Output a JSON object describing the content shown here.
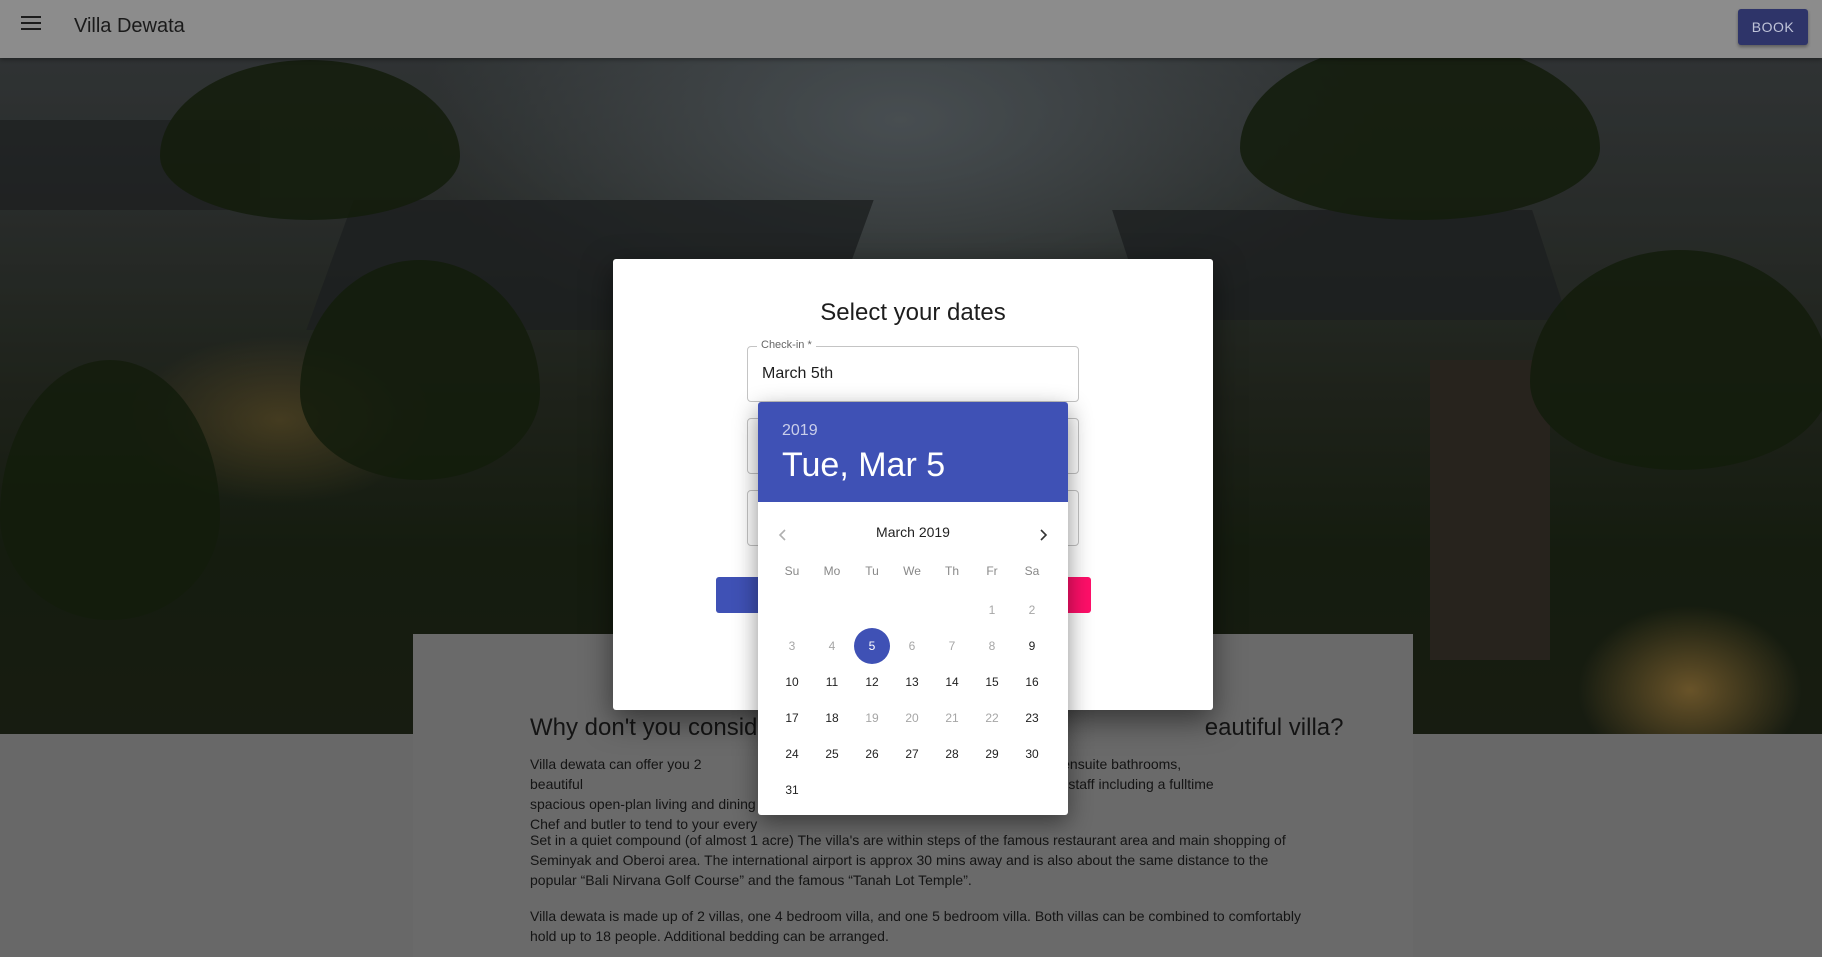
{
  "app": {
    "title": "Villa Dewata",
    "book_label": "BOOK"
  },
  "dialog": {
    "title": "Select your dates",
    "checkin_label": "Check-in *",
    "checkin_value": "March 5th"
  },
  "picker": {
    "year": "2019",
    "selected_date": "Tue, Mar 5",
    "month_label": "March 2019",
    "weekdays": [
      "Su",
      "Mo",
      "Tu",
      "We",
      "Th",
      "Fr",
      "Sa"
    ],
    "weeks": [
      [
        null,
        null,
        null,
        null,
        null,
        {
          "d": "1",
          "state": "disabled"
        },
        {
          "d": "2",
          "state": "disabled"
        }
      ],
      [
        {
          "d": "3",
          "state": "disabled"
        },
        {
          "d": "4",
          "state": "disabled"
        },
        {
          "d": "5",
          "state": "selected"
        },
        {
          "d": "6",
          "state": "disabled"
        },
        {
          "d": "7",
          "state": "disabled"
        },
        {
          "d": "8",
          "state": "disabled"
        },
        {
          "d": "9",
          "state": "normal"
        }
      ],
      [
        {
          "d": "10",
          "state": "normal"
        },
        {
          "d": "11",
          "state": "normal"
        },
        {
          "d": "12",
          "state": "normal"
        },
        {
          "d": "13",
          "state": "normal"
        },
        {
          "d": "14",
          "state": "normal"
        },
        {
          "d": "15",
          "state": "normal"
        },
        {
          "d": "16",
          "state": "normal"
        }
      ],
      [
        {
          "d": "17",
          "state": "normal"
        },
        {
          "d": "18",
          "state": "normal"
        },
        {
          "d": "19",
          "state": "disabled"
        },
        {
          "d": "20",
          "state": "disabled"
        },
        {
          "d": "21",
          "state": "disabled"
        },
        {
          "d": "22",
          "state": "disabled"
        },
        {
          "d": "23",
          "state": "normal"
        }
      ],
      [
        {
          "d": "24",
          "state": "normal"
        },
        {
          "d": "25",
          "state": "normal"
        },
        {
          "d": "26",
          "state": "normal"
        },
        {
          "d": "27",
          "state": "normal"
        },
        {
          "d": "28",
          "state": "normal"
        },
        {
          "d": "29",
          "state": "normal"
        },
        {
          "d": "30",
          "state": "normal"
        }
      ],
      [
        {
          "d": "31",
          "state": "normal"
        },
        null,
        null,
        null,
        null,
        null,
        null
      ]
    ]
  },
  "content": {
    "heading_left": "Why don't you conside",
    "heading_right": "eautiful villa?",
    "p1_left": [
      "Villa dewata can offer you 2 beautiful",
      "spacious open-plan living and dining",
      "Chef and butler to tend to your every"
    ],
    "p1_right": [
      "ms, lovely ensuite bathrooms,",
      "l as trained staff including a fulltime"
    ],
    "p2": "Set in a quiet compound (of almost 1 acre) The villa's are within steps of the famous restaurant area and main shopping of Seminyak and Oberoi area. The international airport is approx 30 mins away and is also about the same distance to the popular “Bali Nirvana Golf Course” and the famous “Tanah Lot Temple”.",
    "p3": "Villa dewata is made up of 2 villas, one 4 bedroom villa, and one 5 bedroom villa. Both villas can be combined to comfortably hold up to 18 people. Additional bedding can be arranged."
  },
  "colors": {
    "primary": "#3f51b5",
    "accent": "#ff0f69",
    "appbar_button": "#2e3469"
  },
  "icons": {
    "menu": "menu-icon",
    "prev": "chevron-left-icon",
    "next": "chevron-right-icon"
  }
}
